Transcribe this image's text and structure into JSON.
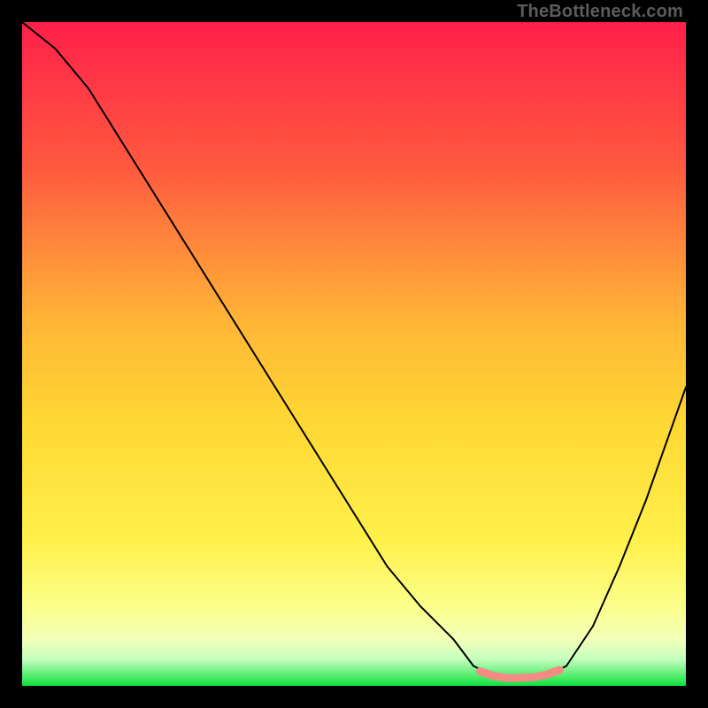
{
  "watermark": "TheBottleneck.com",
  "chart_data": {
    "type": "line",
    "title": "",
    "xlabel": "",
    "ylabel": "",
    "xlim": [
      0,
      100
    ],
    "ylim": [
      0,
      100
    ],
    "grid": false,
    "legend": false,
    "background_gradient": {
      "top": "#ff1f49",
      "mid_upper": "#ff7a3a",
      "mid": "#ffd233",
      "mid_lower": "#fff566",
      "bottom": "#10e03d"
    },
    "series": [
      {
        "name": "bottleneck-curve",
        "color": "#000000",
        "x": [
          0,
          5,
          10,
          15,
          20,
          25,
          30,
          35,
          40,
          45,
          50,
          55,
          60,
          65,
          68,
          72,
          78,
          82,
          86,
          90,
          94,
          100
        ],
        "y": [
          100,
          96,
          90,
          82,
          74,
          66,
          58,
          50,
          42,
          34,
          26,
          18,
          12,
          7,
          3,
          1,
          1,
          3,
          9,
          18,
          28,
          45
        ]
      },
      {
        "name": "sweet-spot-band",
        "color": "#f38b85",
        "style": "thick",
        "x": [
          69,
          71,
          73,
          75,
          77,
          79,
          81
        ],
        "y": [
          2.2,
          1.5,
          1.2,
          1.2,
          1.3,
          1.7,
          2.4
        ]
      }
    ]
  }
}
